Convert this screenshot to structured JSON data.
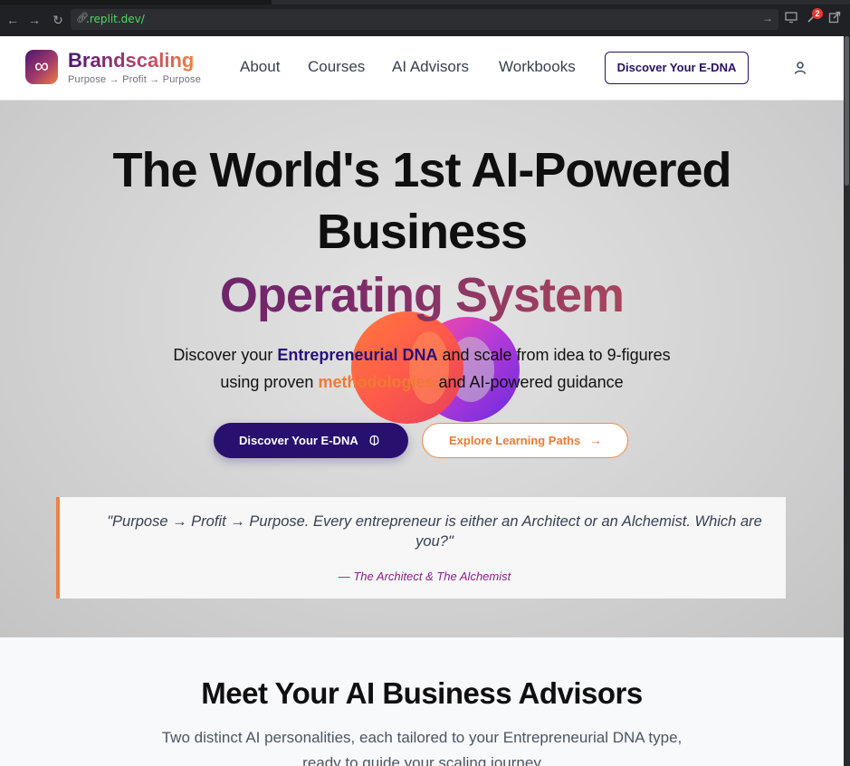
{
  "browser": {
    "url": ".replit.dev/",
    "notification_count": "2"
  },
  "header": {
    "brand_name": "Brandscaling",
    "tagline": "Purpose → Profit → Purpose",
    "logo_symbol": "∞",
    "nav": [
      "About",
      "Courses",
      "AI Advisors",
      "Workbooks"
    ],
    "cta": "Discover Your E-DNA"
  },
  "hero": {
    "title_line1": "The World's 1st AI-Powered",
    "title_line2": "Business",
    "title_line3": "Operating System",
    "sub1_pre": "Discover your ",
    "sub1_hl": "Entrepreneurial DNA",
    "sub1_post": " and scale from idea to 9-figures",
    "sub2_pre": "using proven ",
    "sub2_hl": "methodologies",
    "sub2_post": " and AI-powered guidance",
    "primary_button": "Discover Your E-DNA",
    "secondary_button": "Explore Learning Paths",
    "quote": "\"Purpose → Profit → Purpose. Every entrepreneur is either an Architect or an Alchemist. Which are you?\"",
    "quote_attribution": "— The Architect & The Alchemist"
  },
  "advisors": {
    "title": "Meet Your AI Business Advisors",
    "subtitle_line1": "Two distinct AI personalities, each tailored to your Entrepreneurial DNA type,",
    "subtitle_line2": "ready to guide your scaling journey"
  },
  "colors": {
    "primary": "#28106e",
    "accent": "#f07a33",
    "brand_gradient_start": "#4a1570",
    "brand_gradient_end": "#f08040"
  }
}
